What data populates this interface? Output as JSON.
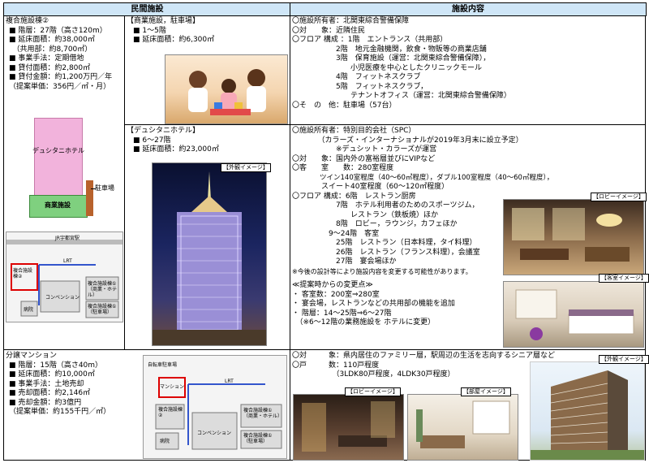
{
  "headers": {
    "left": "民間施設",
    "right": "施設内容"
  },
  "complex": {
    "title": "複合施設棟②",
    "lines": [
      "■ 階層：27階（高さ120m）",
      "■ 延床面積：約38,000㎡",
      "　（共用部：約8,700㎡）",
      "■ 事業手法：定期借地",
      "■ 貸付面積：約2,800㎡",
      "■ 貸付金額：約1,200万円／年",
      "（提案単価：356円／㎡・月）"
    ],
    "diagram": {
      "hotel_label": "デュシタニホテル",
      "shop_label": "商業施設",
      "parking_label": "駐車場"
    },
    "map": {
      "labels": [
        "複合施設棟②",
        "コンベンション",
        "病院",
        "複合施設棟①（商業・ホテル）",
        "複合施設棟①（駐車場）",
        "JR宇都宮駅",
        "LRT"
      ]
    }
  },
  "commercial": {
    "title": "【商業施設，駐車場】",
    "lines": [
      "■ 1～5階",
      "■ 延床面積：約6,300㎡"
    ]
  },
  "commercial_info": {
    "lines": [
      "〇施設所有者：北関東綜合警備保障",
      "〇対　　象：近隣住民",
      "〇フロア 構成 ：1階　エントランス（共用部）",
      "　　　　　　2階　地元金融機関，飲食・物販等の商業店舗",
      "　　　　　　3階　保育施設（運営：北関東綜合警備保障），",
      "　　　　　　　　小児医療を中心としたクリニックモール",
      "　　　　　　4階　フィットネスクラブ",
      "　　　　　　5階　フィットネスクラブ，",
      "　　　　　　　　テナントオフィス（運営：北関東綜合警備保障）",
      "〇そ　の　他：駐車場（57台）"
    ]
  },
  "hotel": {
    "title": "【デュシタニホテル】",
    "lines": [
      "■ 6～27階",
      "■ 延床面積：約23,000㎡"
    ],
    "caption": "【外観イメージ】"
  },
  "hotel_info": {
    "lines": [
      "〇施設所有者：特別目的会社（SPC）",
      "　　　　（カラーズ・インターナショナルが2019年3月末に設立予定）",
      "　　　　　　※デュシット・カラーズが運営",
      "〇対　　象：国内外の富裕層並びにVIPなど",
      "〇客　　室　　数：280室程度",
      "　　　　ツイン140室程度（40～60㎡程度），ダブル100室程度（40～60㎡程度），",
      "　　　　スイート40室程度（60～120㎡程度）",
      "〇フロア 構成：6階　レストラン厨房",
      "　　　　　　7階　ホテル利用者のためのスポーツジム，",
      "　　　　　　　　レストラン（鉄板焼）ほか",
      "　　　　　　8階　ロビー，ラウンジ，カフェほか",
      "　　　　　9～24階　客室",
      "　　　　　　25階　レストラン（日本料理，タイ料理）",
      "　　　　　　26階　レストラン（フランス料理），会議室",
      "　　　　　　27階　宴会場ほか",
      "※今後の設計等により施設内容を変更する可能性があります。"
    ],
    "changes_title": "≪提案時からの変更点≫",
    "changes": [
      "・ 客室数：200室⇒280室",
      "・ 宴会場，レストランなどの共用部の機能を追加",
      "・ 階層：14～25階⇒6～27階",
      "　（※6～12階の業務施設を ホテルに変更）"
    ],
    "lobby_caption": "【ロビーイメージ】",
    "room_caption": "【客室イメージ】"
  },
  "mansion": {
    "title": "分譲マンション",
    "lines": [
      "■ 階層：15階（高さ40m）",
      "■ 延床面積：約10,000㎡",
      "■ 事業手法：土地売却",
      "■ 売却面積：約2,146㎡",
      "■ 売却金額：約3億円",
      "（提案単価：約155千円／㎡）"
    ],
    "map": {
      "labels": [
        "マンション",
        "複合施設棟②",
        "コンベンション",
        "病院",
        "複合施設棟①（商業・ホテル）",
        "複合施設棟①（駐車場）",
        "自転車駐車場",
        "LRT"
      ]
    }
  },
  "mansion_info": {
    "lines": [
      "〇対　　　象：県内居住のファミリー層，駅周辺の生活を志向するシニア層など",
      "〇戸　　　数：110戸程度",
      "　　　　　　（3LDK80戸程度，4LDK30戸程度）"
    ],
    "lobby_caption": "【ロビーイメージ】",
    "room_caption": "【部屋イメージ】",
    "exterior_caption": "【外観イメージ】"
  },
  "colors": {
    "header_bg": "#cfe6f7",
    "tower_pink": "#f2b3dc",
    "shop_green": "#7fd07f",
    "parking_brown": "#b8622c",
    "highlight_red": "#dd0000"
  }
}
